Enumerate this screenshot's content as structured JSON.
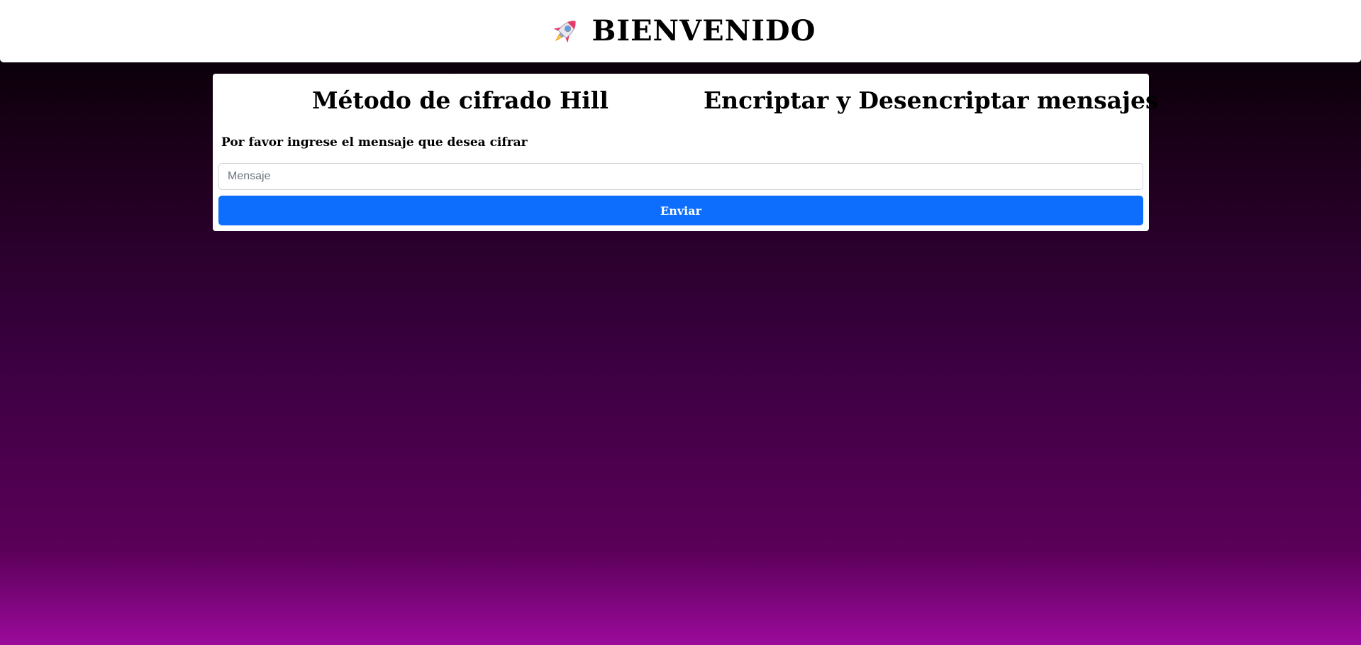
{
  "header": {
    "icon": "rocket-icon",
    "title": "BIENVENIDO"
  },
  "card": {
    "title_left": "Método de cifrado Hill",
    "title_right": "Encriptar y Desencriptar mensajes",
    "prompt": "Por favor ingrese el mensaje que desea cifrar",
    "input": {
      "value": "",
      "placeholder": "Mensaje"
    },
    "submit_label": "Enviar"
  },
  "colors": {
    "button": "#0d6efd",
    "background_top": "#000000",
    "background_bottom": "#9b0a9b"
  }
}
